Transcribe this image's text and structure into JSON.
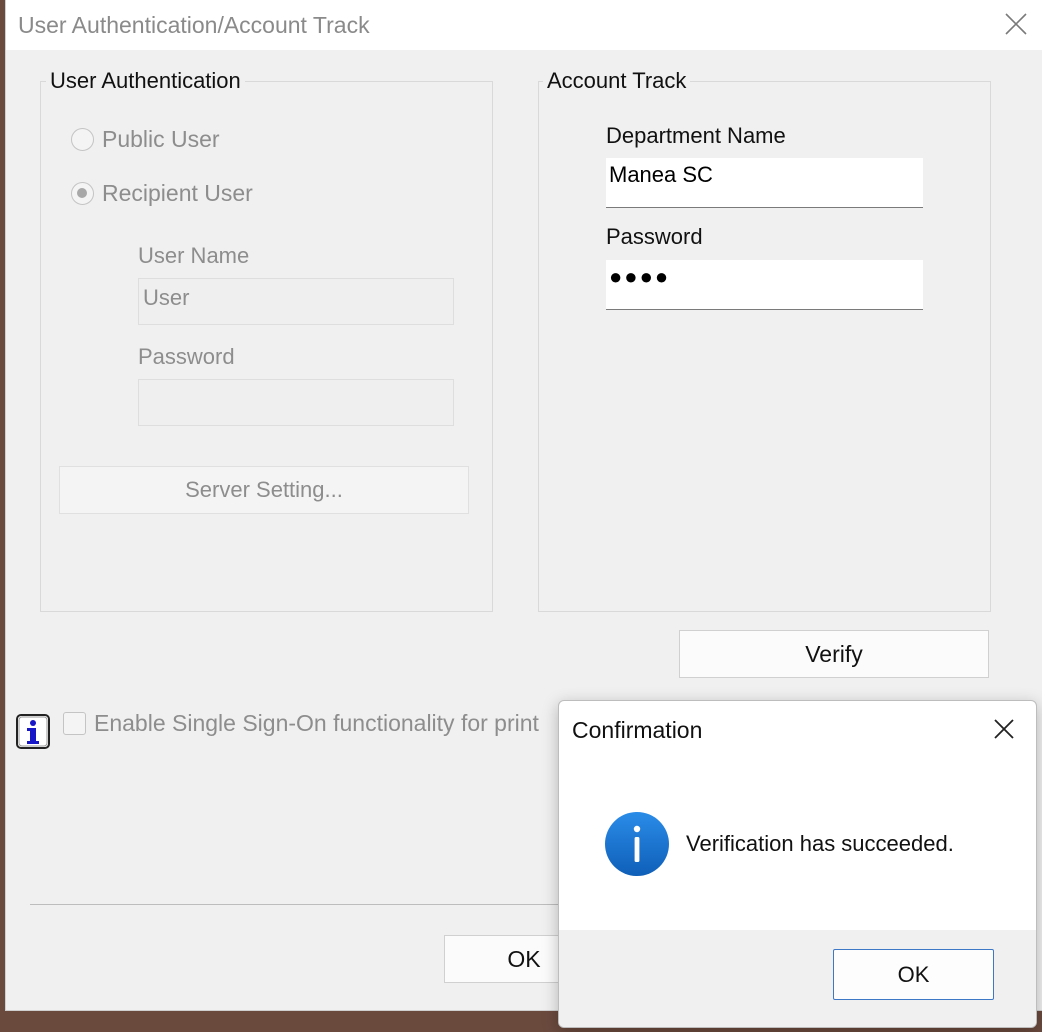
{
  "window": {
    "title": "User Authentication/Account Track"
  },
  "user_auth": {
    "group_title": "User Authentication",
    "public_user_label": "Public User",
    "recipient_user_label": "Recipient User",
    "selected": "Recipient User",
    "user_name_label": "User Name",
    "user_name_value": "User",
    "password_label": "Password",
    "password_value": "",
    "server_setting_label": "Server Setting..."
  },
  "account_track": {
    "group_title": "Account Track",
    "department_name_label": "Department Name",
    "department_name_value": "Manea SC",
    "password_label": "Password",
    "password_value": "●●●●"
  },
  "verify_label": "Verify",
  "sso": {
    "checkbox_label": "Enable Single Sign-On functionality for print",
    "checked": false
  },
  "ok_label": "OK",
  "confirmation": {
    "title": "Confirmation",
    "message": "Verification has succeeded.",
    "ok_label": "OK",
    "icon": "information-icon"
  },
  "colors": {
    "dialog_bg": "#f0f0f0",
    "accent_blue": "#1a78d6",
    "disabled_text": "#8d8d8d"
  }
}
